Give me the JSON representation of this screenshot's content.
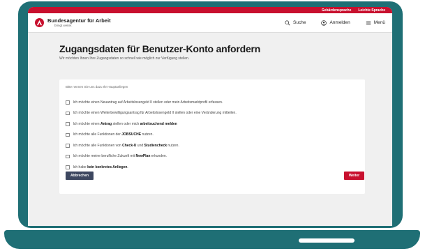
{
  "topbar": {
    "sign_language": "Gebärdensprache",
    "easy_language": "Leichte Sprache"
  },
  "header": {
    "brand_name": "Bundesagentur für Arbeit",
    "brand_tagline": "bringt weiter.",
    "search_label": "Suche",
    "login_label": "Anmelden",
    "menu_label": "Menü"
  },
  "main": {
    "title": "Zugangsdaten für Benutzer-Konto anfordern",
    "intro": "Wir möchten Ihnen Ihre Zugangsdaten so schnell wie möglich zur Verfügung stellen.",
    "hint": "Bitte nennen Sie uns dazu Ihr Hauptanliegen",
    "options": [
      {
        "pre": "Ich möchte einen Neuantrag auf Arbeitslosengeld II stellen oder mein Arbeitsmarktprofil erfassen.",
        "bold": "",
        "post": ""
      },
      {
        "pre": "Ich möchte einen Weiterbewilligungsantrag für Arbeitslosengeld II stellen oder eine Veränderung mitteilen.",
        "bold": "",
        "post": ""
      },
      {
        "pre": "Ich möchte einen ",
        "bold": "Antrag",
        "post": " stellen oder mich ",
        "bold2": "arbeitsuchend melden"
      },
      {
        "pre": "Ich möchte alle Funktionen der ",
        "bold": "JOBSUCHE",
        "post": " nutzen."
      },
      {
        "pre": "Ich möchte alle Funktionen von ",
        "bold": "Check-U",
        "post": " und ",
        "bold2": "Studiencheck",
        "post2": " nutzen."
      },
      {
        "pre": "Ich möchte meine berufliche Zukunft mit ",
        "bold": "NewPlan",
        "post": " erkunden."
      },
      {
        "pre": "Ich habe ",
        "bold": "kein konkretes Anliegen",
        "post": "."
      }
    ],
    "cancel_label": "Abbrechen",
    "next_label": "Weiter"
  },
  "colors": {
    "brand_red": "#c8102e",
    "frame_teal": "#1f6f75",
    "cancel_navy": "#3d4760"
  },
  "icons": {
    "search": "search-icon",
    "login": "user-circle-icon",
    "menu": "hamburger-menu-icon",
    "logo": "ba-logo-icon"
  }
}
